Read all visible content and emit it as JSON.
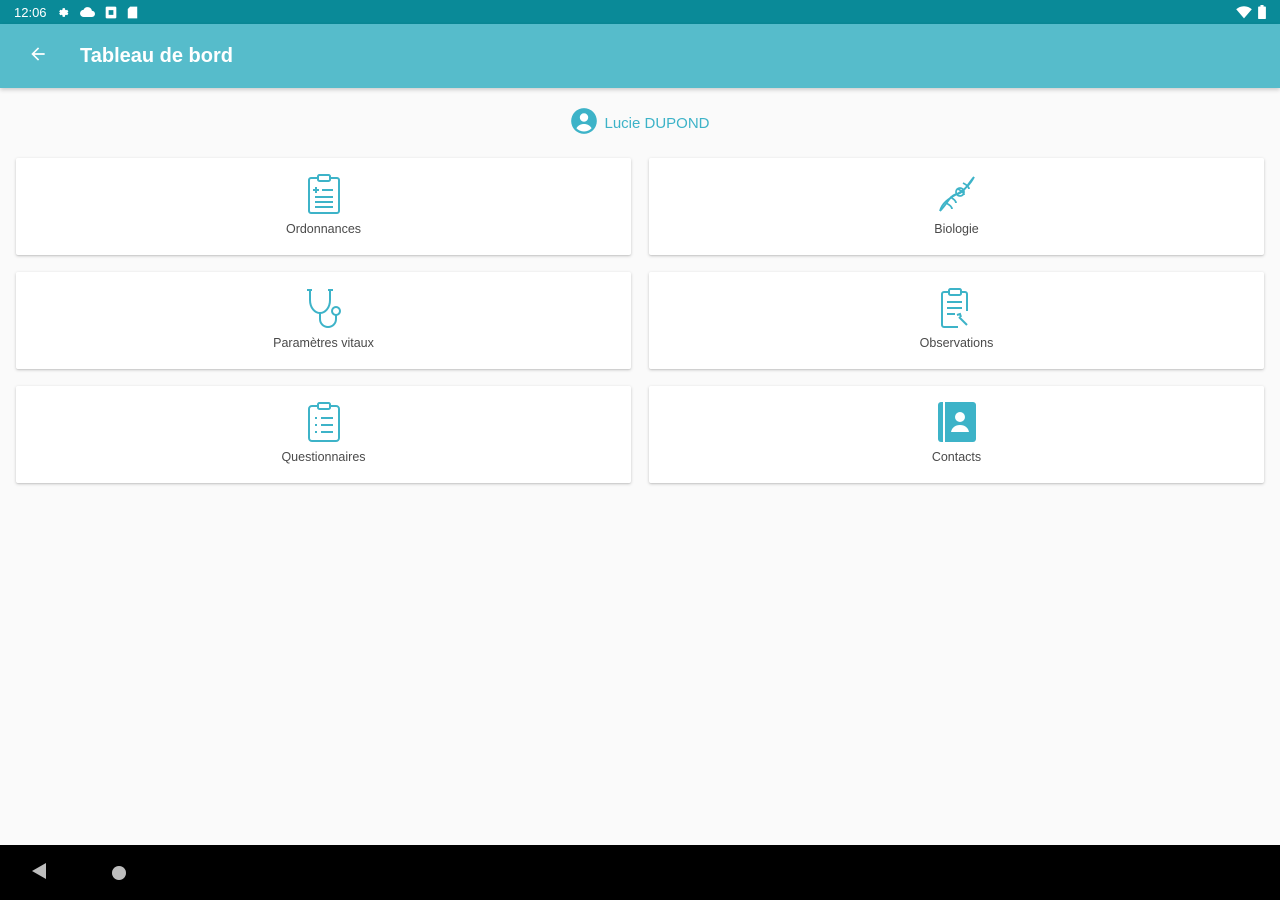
{
  "status_bar": {
    "time": "12:06",
    "icons": [
      "gear-icon",
      "cloud-icon",
      "sim-card-icon",
      "sd-card-icon"
    ],
    "right_icons": [
      "wifi-icon",
      "battery-icon"
    ]
  },
  "app_bar": {
    "title": "Tableau de bord",
    "back_icon": "arrow-back-icon"
  },
  "user": {
    "name": "Lucie DUPOND",
    "icon": "account-circle-icon"
  },
  "tiles": [
    {
      "label": "Ordonnances",
      "icon": "clipboard-prescription-icon"
    },
    {
      "label": "Biologie",
      "icon": "dna-icon"
    },
    {
      "label": "Paramètres vitaux",
      "icon": "stethoscope-icon"
    },
    {
      "label": "Observations",
      "icon": "clipboard-edit-icon"
    },
    {
      "label": "Questionnaires",
      "icon": "clipboard-list-icon"
    },
    {
      "label": "Contacts",
      "icon": "contact-book-icon"
    }
  ],
  "colors": {
    "status_bar": "#0a8a98",
    "app_bar": "#56bccb",
    "accent": "#3db3c8",
    "background": "#fafafa",
    "nav_bar": "#000000"
  }
}
